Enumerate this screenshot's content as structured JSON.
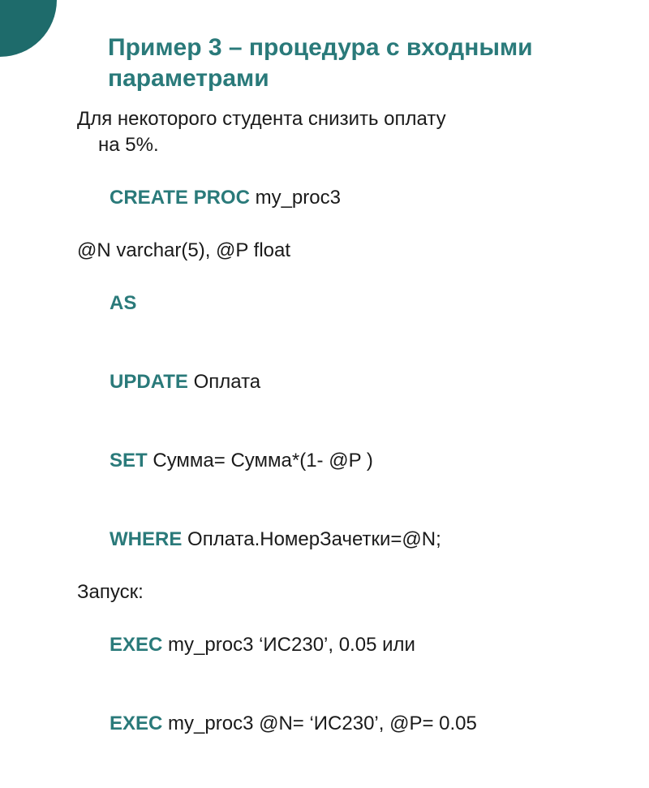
{
  "slide": {
    "title": "Пример 3 – процедура с входными параметрами",
    "desc_l1": "Для некоторого студента снизить оплату",
    "desc_l2": "на 5%.",
    "kw_create": "CREATE PROC",
    "proc_name": " my_proc3",
    "params_line": "@N varchar(5), @P float",
    "kw_as": "AS",
    "kw_update": "UPDATE",
    "update_tbl": " Оплата",
    "kw_set": "SET",
    "set_expr": " Сумма= Сумма*(1- @P )",
    "kw_where": "WHERE",
    "where_expr": " Оплата.НомерЗачетки=@N;",
    "run_label": "Запуск:",
    "kw_exec1": "EXEC",
    "exec1_rest": " my_proc3 ‘ИС230’, 0.05 или",
    "kw_exec2": "EXEC",
    "exec2_rest": " my_proc3 @N= ‘ИС230’, @P= 0.05"
  }
}
